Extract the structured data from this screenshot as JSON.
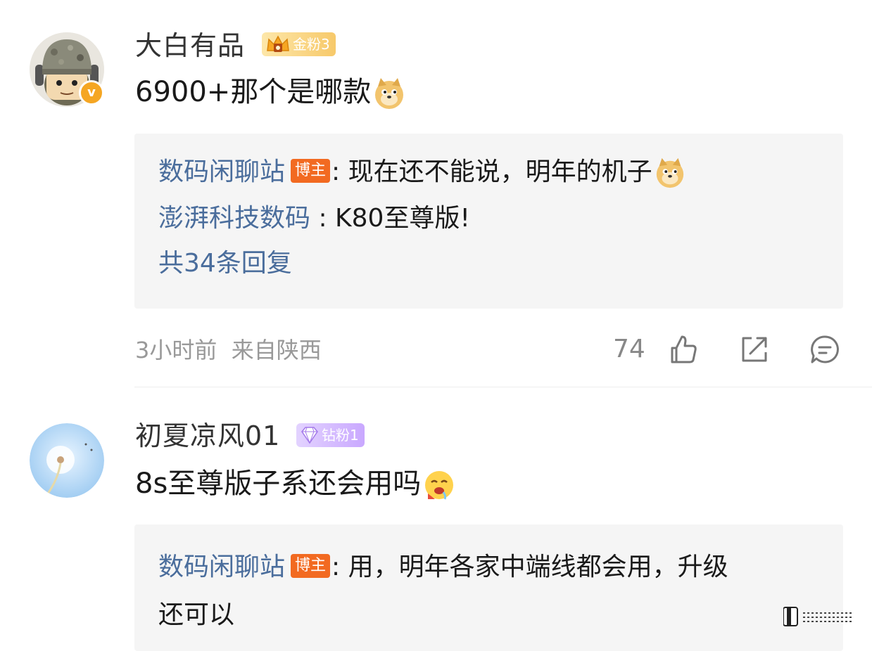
{
  "comments": [
    {
      "username": "大白有品",
      "fan_badge": "金粉3",
      "text": "6900+那个是哪款",
      "emoji": "doge-emoji",
      "replies": [
        {
          "name": "数码闲聊站",
          "host_badge": "博主",
          "text": ": 现在还不能说，明年的机子",
          "emoji": "doge-emoji"
        },
        {
          "name": "澎湃科技数码",
          "text": " : K80至尊版!"
        }
      ],
      "more_replies": "共34条回复",
      "time": "3小时前",
      "location": "来自陕西",
      "like_count": "74"
    },
    {
      "username": "初夏凉风01",
      "fan_badge": "钻粉1",
      "text": "8s至尊版子系还会用吗",
      "emoji": "drooling-emoji",
      "replies": [
        {
          "name": "数码闲聊站",
          "host_badge": "博主",
          "text": ": 用，明年各家中端线都会用，升级",
          "text_line2": "还可以"
        }
      ]
    }
  ],
  "colors": {
    "link": "#4a6d9c",
    "host_badge": "#f26a21",
    "meta": "#999999"
  },
  "icons": [
    "soldier-avatar",
    "verified-v-icon",
    "crown-icon",
    "diamond-icon",
    "thumb-up-icon",
    "share-icon",
    "comment-icon",
    "dandelion-avatar"
  ]
}
